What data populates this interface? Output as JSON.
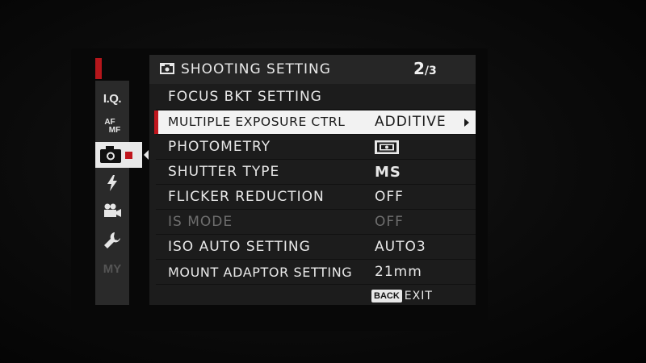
{
  "header": {
    "title": "SHOOTING SETTING",
    "page_current": "2",
    "page_total": "/3",
    "icon": "camera-icon"
  },
  "sidebar": {
    "tabs": [
      {
        "label": "I.Q.",
        "icon": "image-quality-icon"
      },
      {
        "label_top": "AF",
        "label_bottom": "MF",
        "icon": "af-mf-icon"
      },
      {
        "icon": "camera-icon",
        "selected": true
      },
      {
        "icon": "flash-icon"
      },
      {
        "icon": "movie-icon"
      },
      {
        "icon": "wrench-icon"
      },
      {
        "label": "MY",
        "icon": "my-menu-icon"
      }
    ],
    "accent_color": "#b5161b"
  },
  "menu": {
    "items": [
      {
        "label": "FOCUS BKT SETTING",
        "value": ""
      },
      {
        "label": "MULTIPLE EXPOSURE CTRL",
        "value": "ADDITIVE"
      },
      {
        "label": "PHOTOMETRY",
        "value": "",
        "value_icon": "multi-metering-icon"
      },
      {
        "label": "SHUTTER TYPE",
        "value": "MS"
      },
      {
        "label": "FLICKER REDUCTION",
        "value": "OFF"
      },
      {
        "label": "IS MODE",
        "value": "OFF"
      },
      {
        "label": "ISO AUTO SETTING",
        "value": "AUTO3"
      },
      {
        "label": "MOUNT ADAPTOR SETTING",
        "value": "21mm"
      }
    ]
  },
  "footer": {
    "back_badge": "BACK",
    "exit_label": "EXIT"
  },
  "colors": {
    "selection_bg": "#f2f2f2",
    "selection_marker": "#c0161d",
    "panel_bg": "#1c1c1c",
    "disabled_text": "#6e6e6e"
  }
}
